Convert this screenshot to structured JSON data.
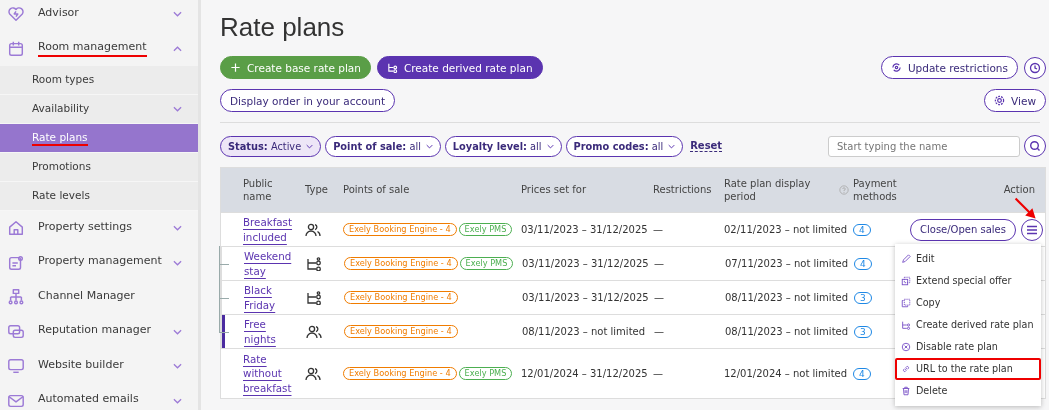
{
  "sidebar": {
    "items": [
      {
        "label": "Advisor",
        "expanded": false,
        "highlighted": false
      },
      {
        "label": "Room management",
        "expanded": true,
        "highlighted": true,
        "children": [
          {
            "label": "Room types",
            "selected": false,
            "highlighted": false
          },
          {
            "label": "Availability",
            "expanded": false,
            "selected": false,
            "highlighted": false
          },
          {
            "label": "Rate plans",
            "selected": true,
            "highlighted": true
          },
          {
            "label": "Promotions",
            "selected": false,
            "highlighted": false
          },
          {
            "label": "Rate levels",
            "selected": false,
            "highlighted": false
          }
        ]
      },
      {
        "label": "Property settings",
        "expanded": false,
        "highlighted": false
      },
      {
        "label": "Property management",
        "expanded": false,
        "highlighted": false
      },
      {
        "label": "Channel Manager",
        "highlighted": false
      },
      {
        "label": "Reputation manager",
        "expanded": false,
        "highlighted": false
      },
      {
        "label": "Website builder",
        "expanded": false,
        "highlighted": false
      },
      {
        "label": "Automated emails",
        "expanded": false,
        "highlighted": false
      }
    ]
  },
  "page": {
    "title": "Rate plans",
    "create_base_button": "Create base rate plan",
    "create_derived_button": "Create derived rate plan",
    "update_restrictions_button": "Update restrictions",
    "display_order_button": "Display order in your account",
    "view_button": "View"
  },
  "filters": [
    {
      "label": "Status:",
      "value": "Active",
      "selected": true
    },
    {
      "label": "Point of sale:",
      "value": "all",
      "selected": false
    },
    {
      "label": "Loyalty level:",
      "value": "all",
      "selected": false
    },
    {
      "label": "Promo codes:",
      "value": "all",
      "selected": false
    }
  ],
  "reset_link": "Reset",
  "search": {
    "placeholder": "Start typing the name"
  },
  "table": {
    "columns": [
      "Public name",
      "Type",
      "Points of sale",
      "Prices set for",
      "Restrictions",
      "Rate plan display period",
      "Payment methods",
      "Action"
    ],
    "rows": [
      {
        "name": "Breakfast included",
        "kind": "base",
        "points_of_sale": [
          {
            "label": "Exely Booking Engine - 4",
            "color": "#f07c00"
          },
          {
            "label": "Exely PMS",
            "color": "#4caf50"
          }
        ],
        "prices": "03/11/2023 – 31/12/2025",
        "restrictions": "—",
        "period": "02/11/2023 – not limited",
        "payment": "4",
        "selected": false,
        "action_button": "Close/Open sales",
        "menu_open": true,
        "annotated": true,
        "children": [
          {
            "name": "Weekend stay",
            "kind": "derived",
            "points_of_sale": [
              {
                "label": "Exely Booking Engine - 4",
                "color": "#f07c00"
              },
              {
                "label": "Exely PMS",
                "color": "#4caf50"
              }
            ],
            "prices": "03/11/2023 – 31/12/2025",
            "restrictions": "—",
            "period": "07/11/2023 – not limited",
            "payment": "4",
            "selected": false
          },
          {
            "name": "Black Friday",
            "kind": "derived",
            "points_of_sale": [
              {
                "label": "Exely Booking Engine - 4",
                "color": "#f07c00"
              }
            ],
            "prices": "03/11/2023 – 31/12/2025",
            "restrictions": "—",
            "period": "08/11/2023 – not limited",
            "payment": "3",
            "selected": false
          },
          {
            "name": "Free nights",
            "kind": "base",
            "points_of_sale": [
              {
                "label": "Exely Booking Engine - 4",
                "color": "#f07c00"
              }
            ],
            "prices": "08/11/2023 – not limited",
            "restrictions": "—",
            "period": "08/11/2023 – not limited",
            "payment": "3",
            "selected": true
          }
        ]
      },
      {
        "name": "Rate without breakfast",
        "kind": "base",
        "points_of_sale": [
          {
            "label": "Exely Booking Engine - 4",
            "color": "#f07c00"
          },
          {
            "label": "Exely PMS",
            "color": "#4caf50"
          }
        ],
        "prices": "12/01/2024 – 31/12/2025",
        "restrictions": "—",
        "period": "12/01/2024 – not limited",
        "payment": "4",
        "selected": false,
        "children": []
      }
    ]
  },
  "action_menu": [
    {
      "label": "Edit",
      "highlighted": false
    },
    {
      "label": "Extend special offer",
      "highlighted": false
    },
    {
      "label": "Copy",
      "highlighted": false
    },
    {
      "label": "Create derived rate plan",
      "highlighted": false
    },
    {
      "label": "Disable rate plan",
      "highlighted": false
    },
    {
      "label": "URL to the rate plan",
      "highlighted": true
    },
    {
      "label": "Delete",
      "highlighted": false
    }
  ]
}
